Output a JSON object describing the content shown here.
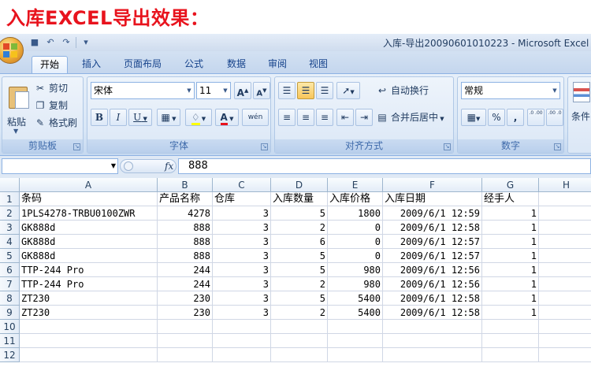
{
  "caption": "入库EXCEL导出效果：",
  "window": {
    "title": "入库-导出20090601010223 - Microsoft Excel"
  },
  "quick_access": {
    "save_icon": "save-icon",
    "undo_icon": "undo-icon",
    "redo_icon": "redo-icon",
    "customize_icon": "customize-qat-icon"
  },
  "tabs": [
    "开始",
    "插入",
    "页面布局",
    "公式",
    "数据",
    "审阅",
    "视图"
  ],
  "ribbon": {
    "clipboard": {
      "label": "剪贴板",
      "paste": "粘贴",
      "cut": "剪切",
      "copy": "复制",
      "format_painter": "格式刷"
    },
    "font": {
      "label": "字体",
      "font_name": "宋体",
      "font_size": "11",
      "grow": "A",
      "shrink": "A",
      "bold": "B",
      "italic": "I",
      "underline": "U",
      "phonetic": "wén",
      "font_color": "A"
    },
    "alignment": {
      "label": "对齐方式",
      "wrap_text": "自动换行",
      "merge_center": "合并后居中"
    },
    "number": {
      "label": "数字",
      "format": "常规",
      "percent": "%",
      "comma": ",",
      "inc_decimal": ".0 .00",
      "dec_decimal": ".00 .0"
    },
    "styles": {
      "conditional": "条件"
    }
  },
  "formula_bar": {
    "name_box": "",
    "fx": "fx",
    "value": "888"
  },
  "sheet": {
    "columns": [
      "A",
      "B",
      "C",
      "D",
      "E",
      "F",
      "G",
      "H"
    ],
    "row_numbers": [
      "1",
      "2",
      "3",
      "4",
      "5",
      "6",
      "7",
      "8",
      "9",
      "10",
      "11",
      "12"
    ],
    "header": [
      "条码",
      "产品名称",
      "仓库",
      "入库数量",
      "入库价格",
      "入库日期",
      "经手人"
    ],
    "rows": [
      [
        "1PLS4278-TRBU0100ZWR",
        "4278",
        "3",
        "5",
        "1800",
        "2009/6/1 12:59",
        "1"
      ],
      [
        "GK888d",
        "888",
        "3",
        "2",
        "0",
        "2009/6/1 12:58",
        "1"
      ],
      [
        "GK888d",
        "888",
        "3",
        "6",
        "0",
        "2009/6/1 12:57",
        "1"
      ],
      [
        "GK888d",
        "888",
        "3",
        "5",
        "0",
        "2009/6/1 12:57",
        "1"
      ],
      [
        "TTP-244 Pro",
        "244",
        "3",
        "5",
        "980",
        "2009/6/1 12:56",
        "1"
      ],
      [
        "TTP-244 Pro",
        "244",
        "3",
        "2",
        "980",
        "2009/6/1 12:56",
        "1"
      ],
      [
        "ZT230",
        "230",
        "3",
        "5",
        "5400",
        "2009/6/1 12:58",
        "1"
      ],
      [
        "ZT230",
        "230",
        "3",
        "2",
        "5400",
        "2009/6/1 12:58",
        "1"
      ]
    ]
  },
  "colors": {
    "caption": "#e8131d",
    "ribbon": "#dfe9f5",
    "tab_text": "#15428b"
  }
}
